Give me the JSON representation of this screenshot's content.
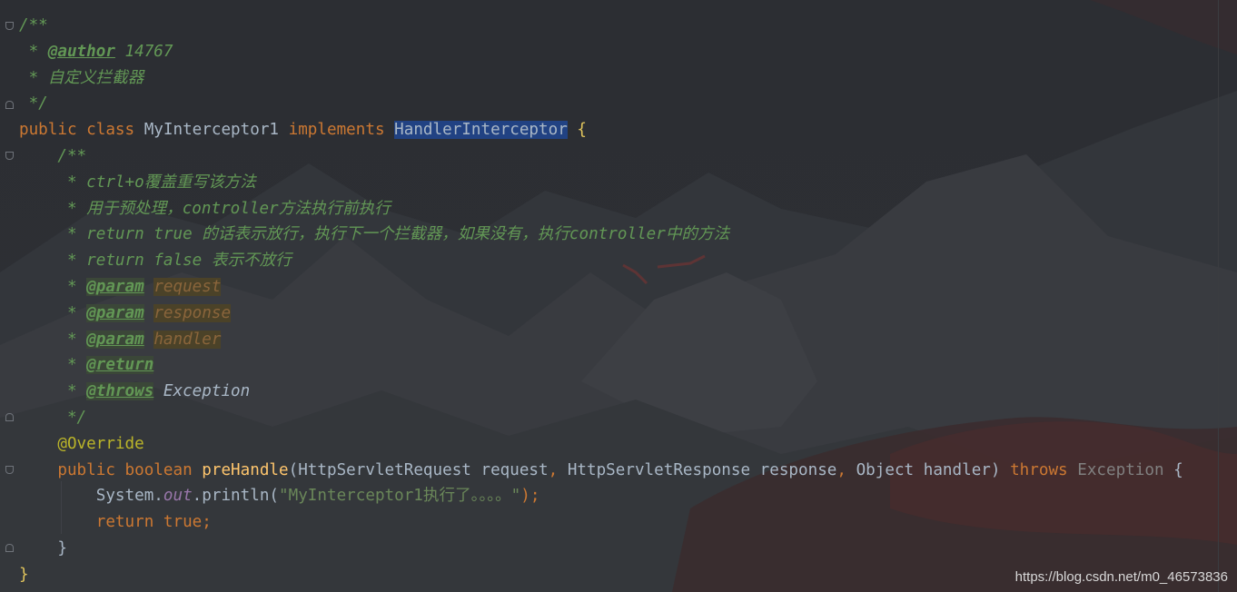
{
  "editor": {
    "lines": [
      {
        "segments": [
          {
            "t": "/**",
            "c": "c-doc"
          }
        ]
      },
      {
        "segments": [
          {
            "t": " * ",
            "c": "c-doc"
          },
          {
            "t": "@author",
            "c": "c-tag"
          },
          {
            "t": " 14767",
            "c": "c-doc"
          }
        ]
      },
      {
        "segments": [
          {
            "t": " * 自定义拦截器",
            "c": "c-doc"
          }
        ]
      },
      {
        "segments": [
          {
            "t": " */",
            "c": "c-doc"
          }
        ]
      },
      {
        "segments": [
          {
            "t": "public ",
            "c": "kw"
          },
          {
            "t": "class ",
            "c": "kw"
          },
          {
            "t": "MyInterceptor1 ",
            "c": "id"
          },
          {
            "t": "implements ",
            "c": "kw"
          },
          {
            "t": "HandlerInterceptor",
            "c": "sel"
          },
          {
            "t": " {",
            "c": "brace"
          }
        ]
      },
      {
        "segments": [
          {
            "t": "    /**",
            "c": "c-doc"
          }
        ]
      },
      {
        "segments": [
          {
            "t": "     * ctrl+o覆盖重写该方法",
            "c": "c-doc"
          }
        ]
      },
      {
        "segments": [
          {
            "t": "     * 用于预处理，controller方法执行前执行",
            "c": "c-doc"
          }
        ]
      },
      {
        "segments": [
          {
            "t": "     * return true 的话表示放行，执行下一个拦截器，如果没有，执行controller中的方法",
            "c": "c-doc"
          }
        ]
      },
      {
        "segments": [
          {
            "t": "     * return false 表示不放行",
            "c": "c-doc"
          }
        ]
      },
      {
        "segments": [
          {
            "t": "     * ",
            "c": "c-doc"
          },
          {
            "t": "@param",
            "c": "c-tag c-tagbg"
          },
          {
            "t": " ",
            "c": "c-doc"
          },
          {
            "t": "request",
            "c": "c-pname"
          }
        ]
      },
      {
        "segments": [
          {
            "t": "     * ",
            "c": "c-doc"
          },
          {
            "t": "@param",
            "c": "c-tag c-tagbg"
          },
          {
            "t": " ",
            "c": "c-doc"
          },
          {
            "t": "response",
            "c": "c-pname"
          }
        ]
      },
      {
        "segments": [
          {
            "t": "     * ",
            "c": "c-doc"
          },
          {
            "t": "@param",
            "c": "c-tag c-tagbg"
          },
          {
            "t": " ",
            "c": "c-doc"
          },
          {
            "t": "handler",
            "c": "c-pname"
          }
        ]
      },
      {
        "segments": [
          {
            "t": "     * ",
            "c": "c-doc"
          },
          {
            "t": "@return",
            "c": "c-tag c-tagbg"
          }
        ]
      },
      {
        "segments": [
          {
            "t": "     * ",
            "c": "c-doc"
          },
          {
            "t": "@throws",
            "c": "c-tag c-tagbg"
          },
          {
            "t": " ",
            "c": "c-doc"
          },
          {
            "t": "Exception",
            "c": "c-ref"
          }
        ]
      },
      {
        "segments": [
          {
            "t": "     */",
            "c": "c-doc"
          }
        ]
      },
      {
        "segments": [
          {
            "t": "    @Override",
            "c": "ann"
          }
        ]
      },
      {
        "segments": [
          {
            "t": "    public ",
            "c": "kw"
          },
          {
            "t": "boolean ",
            "c": "kw"
          },
          {
            "t": "preHandle",
            "c": "fn"
          },
          {
            "t": "(HttpServletRequest request",
            "c": "id"
          },
          {
            "t": ", ",
            "c": "kw"
          },
          {
            "t": "HttpServletResponse response",
            "c": "id"
          },
          {
            "t": ", ",
            "c": "kw"
          },
          {
            "t": "Object handler) ",
            "c": "id"
          },
          {
            "t": "throws ",
            "c": "kw"
          },
          {
            "t": "Exception ",
            "c": "kwdim"
          },
          {
            "t": "{",
            "c": "id"
          }
        ]
      },
      {
        "segments": [
          {
            "t": "        System.",
            "c": "id"
          },
          {
            "t": "out",
            "c": "field"
          },
          {
            "t": ".println(",
            "c": "id"
          },
          {
            "t": "\"MyInterceptor1执行了。。。。\"",
            "c": "str"
          },
          {
            "t": ");",
            "c": "kw"
          }
        ]
      },
      {
        "segments": [
          {
            "t": "        return ",
            "c": "kw"
          },
          {
            "t": "true",
            "c": "kw"
          },
          {
            "t": ";",
            "c": "kw"
          }
        ]
      },
      {
        "segments": [
          {
            "t": "    }",
            "c": "id"
          }
        ]
      },
      {
        "segments": [
          {
            "t": "}",
            "c": "brace"
          }
        ]
      }
    ]
  },
  "watermark": "https://blog.csdn.net/m0_46573836",
  "colors": {
    "background": "#2b2d31",
    "doc_comment": "#629755",
    "keyword": "#cc7832",
    "selection": "#214283",
    "annotation": "#bbb529",
    "method": "#ffc66d",
    "string": "#6a8759"
  }
}
